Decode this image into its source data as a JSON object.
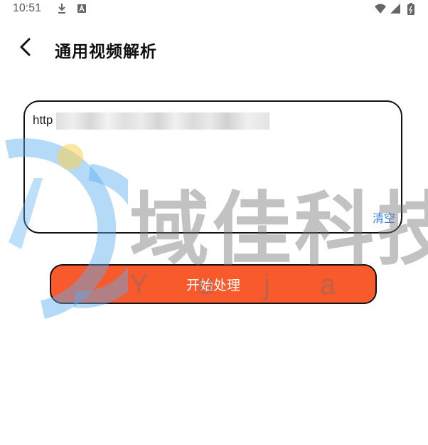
{
  "status_bar": {
    "time": "10:51",
    "left_icons": [
      "download-icon",
      "app-badge-icon"
    ],
    "right_icons": [
      "wifi-icon",
      "signal-icon",
      "battery-icon"
    ]
  },
  "header": {
    "back_icon": "chevron-left-icon",
    "title": "通用视频解析"
  },
  "url_input": {
    "value": "http"
  },
  "clear_label": "清空",
  "start_button_label": "开始处理",
  "watermark": {
    "text": "域佳科技",
    "letters": [
      "Y",
      "u",
      "j",
      "a"
    ]
  },
  "colors": {
    "accent": "#f95a2c",
    "link": "#3b7fd9",
    "watermark_blue": "#5aaef0"
  }
}
